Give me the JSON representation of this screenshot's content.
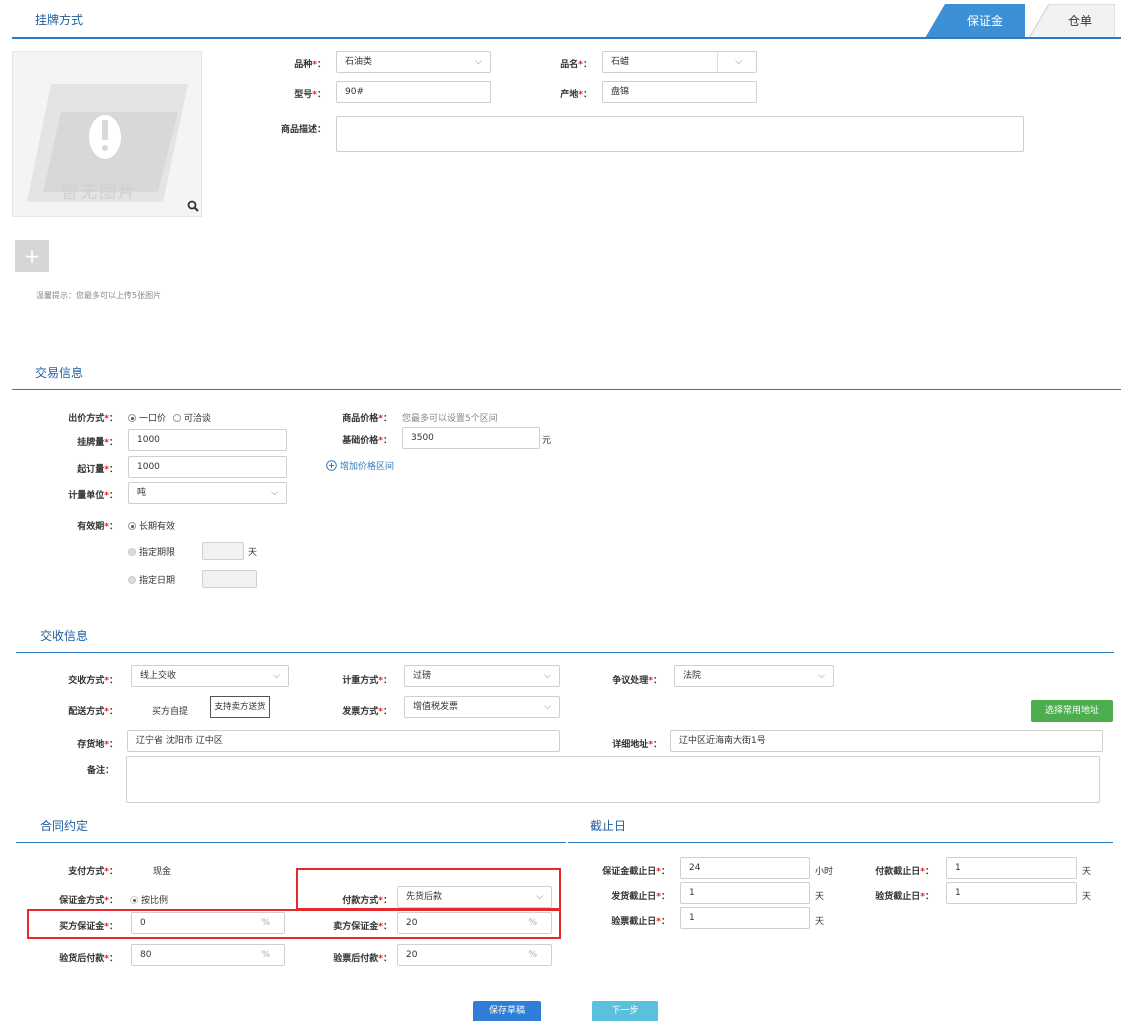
{
  "tabs": {
    "deposit": "保证金",
    "warehouse": "仓单"
  },
  "listing": {
    "title": "挂牌方式",
    "no_image_text": "暂无图片",
    "upload_tip": "温馨提示：您最多可以上传5张图片",
    "variety": {
      "label": "品种",
      "value": "石油类"
    },
    "product_name": {
      "label": "品名",
      "value": "石蜡"
    },
    "model": {
      "label": "型号",
      "value": "90#"
    },
    "origin": {
      "label": "产地",
      "value": "盘锦"
    },
    "description": {
      "label": "商品描述：",
      "value": ""
    }
  },
  "trade": {
    "title": "交易信息",
    "price_mode": {
      "label": "出价方式",
      "option_fixed": "一口价",
      "option_negotiable": "可洽谈"
    },
    "listing_qty": {
      "label": "挂牌量",
      "value": "1000"
    },
    "min_order": {
      "label": "起订量",
      "value": "1000"
    },
    "unit": {
      "label": "计量单位",
      "value": "吨"
    },
    "validity": {
      "label": "有效期",
      "option_long": "长期有效",
      "option_period": "指定期限",
      "period_unit": "天",
      "option_date": "指定日期"
    },
    "goods_price": {
      "label": "商品价格",
      "hint": "您最多可以设置5个区间"
    },
    "base_price": {
      "label": "基础价格",
      "value": "3500",
      "unit": "元"
    },
    "add_range": "增加价格区间"
  },
  "delivery": {
    "title": "交收信息",
    "mode": {
      "label": "交收方式",
      "value": "线上交收"
    },
    "metering": {
      "label": "计重方式",
      "value": "过磅"
    },
    "dispute": {
      "label": "争议处理",
      "value": "法院"
    },
    "distribution": {
      "label": "配送方式",
      "option_pickup": "买方自提",
      "option_ship": "支持卖方送货"
    },
    "invoice": {
      "label": "发票方式",
      "value": "增值税发票"
    },
    "choose_address": "选择常用地址",
    "storage": {
      "label": "存货地",
      "value": "辽宁省 沈阳市 辽中区"
    },
    "address": {
      "label": "详细地址",
      "value": "辽中区近海南大街1号"
    },
    "remark": {
      "label": "备注：",
      "value": ""
    }
  },
  "contract": {
    "title": "合同约定",
    "payment_method": {
      "label": "支付方式",
      "value": "现金"
    },
    "deposit_mode": {
      "label": "保证金方式",
      "value": "按比例"
    },
    "payment_type": {
      "label": "付款方式",
      "value": "先货后款"
    },
    "buyer_deposit": {
      "label": "买方保证金",
      "value": "0",
      "unit": "%"
    },
    "seller_deposit": {
      "label": "卖方保证金",
      "value": "20",
      "unit": "%"
    },
    "pay_after_receipt": {
      "label": "验货后付款",
      "value": "80",
      "unit": "%"
    },
    "pay_after_invoice": {
      "label": "验票后付款",
      "value": "20",
      "unit": "%"
    }
  },
  "deadline": {
    "title": "截止日",
    "deposit_deadline": {
      "label": "保证金截止日",
      "value": "24",
      "unit": "小时"
    },
    "payment_deadline": {
      "label": "付款截止日",
      "value": "1",
      "unit": "天"
    },
    "ship_deadline": {
      "label": "发货截止日",
      "value": "1",
      "unit": "天"
    },
    "inspect_deadline": {
      "label": "验货截止日",
      "value": "1",
      "unit": "天"
    },
    "invoice_deadline": {
      "label": "验票截止日",
      "value": "1",
      "unit": "天"
    }
  },
  "actions": {
    "save_draft": "保存草稿",
    "next": "下一步"
  },
  "colors": {
    "accent": "#2f79c0",
    "tab_active": "#3d8fd6",
    "green": "#4cae4c",
    "button_blue": "#2f7ed8",
    "button_light": "#5bc0de",
    "highlight": "#e5292d"
  }
}
